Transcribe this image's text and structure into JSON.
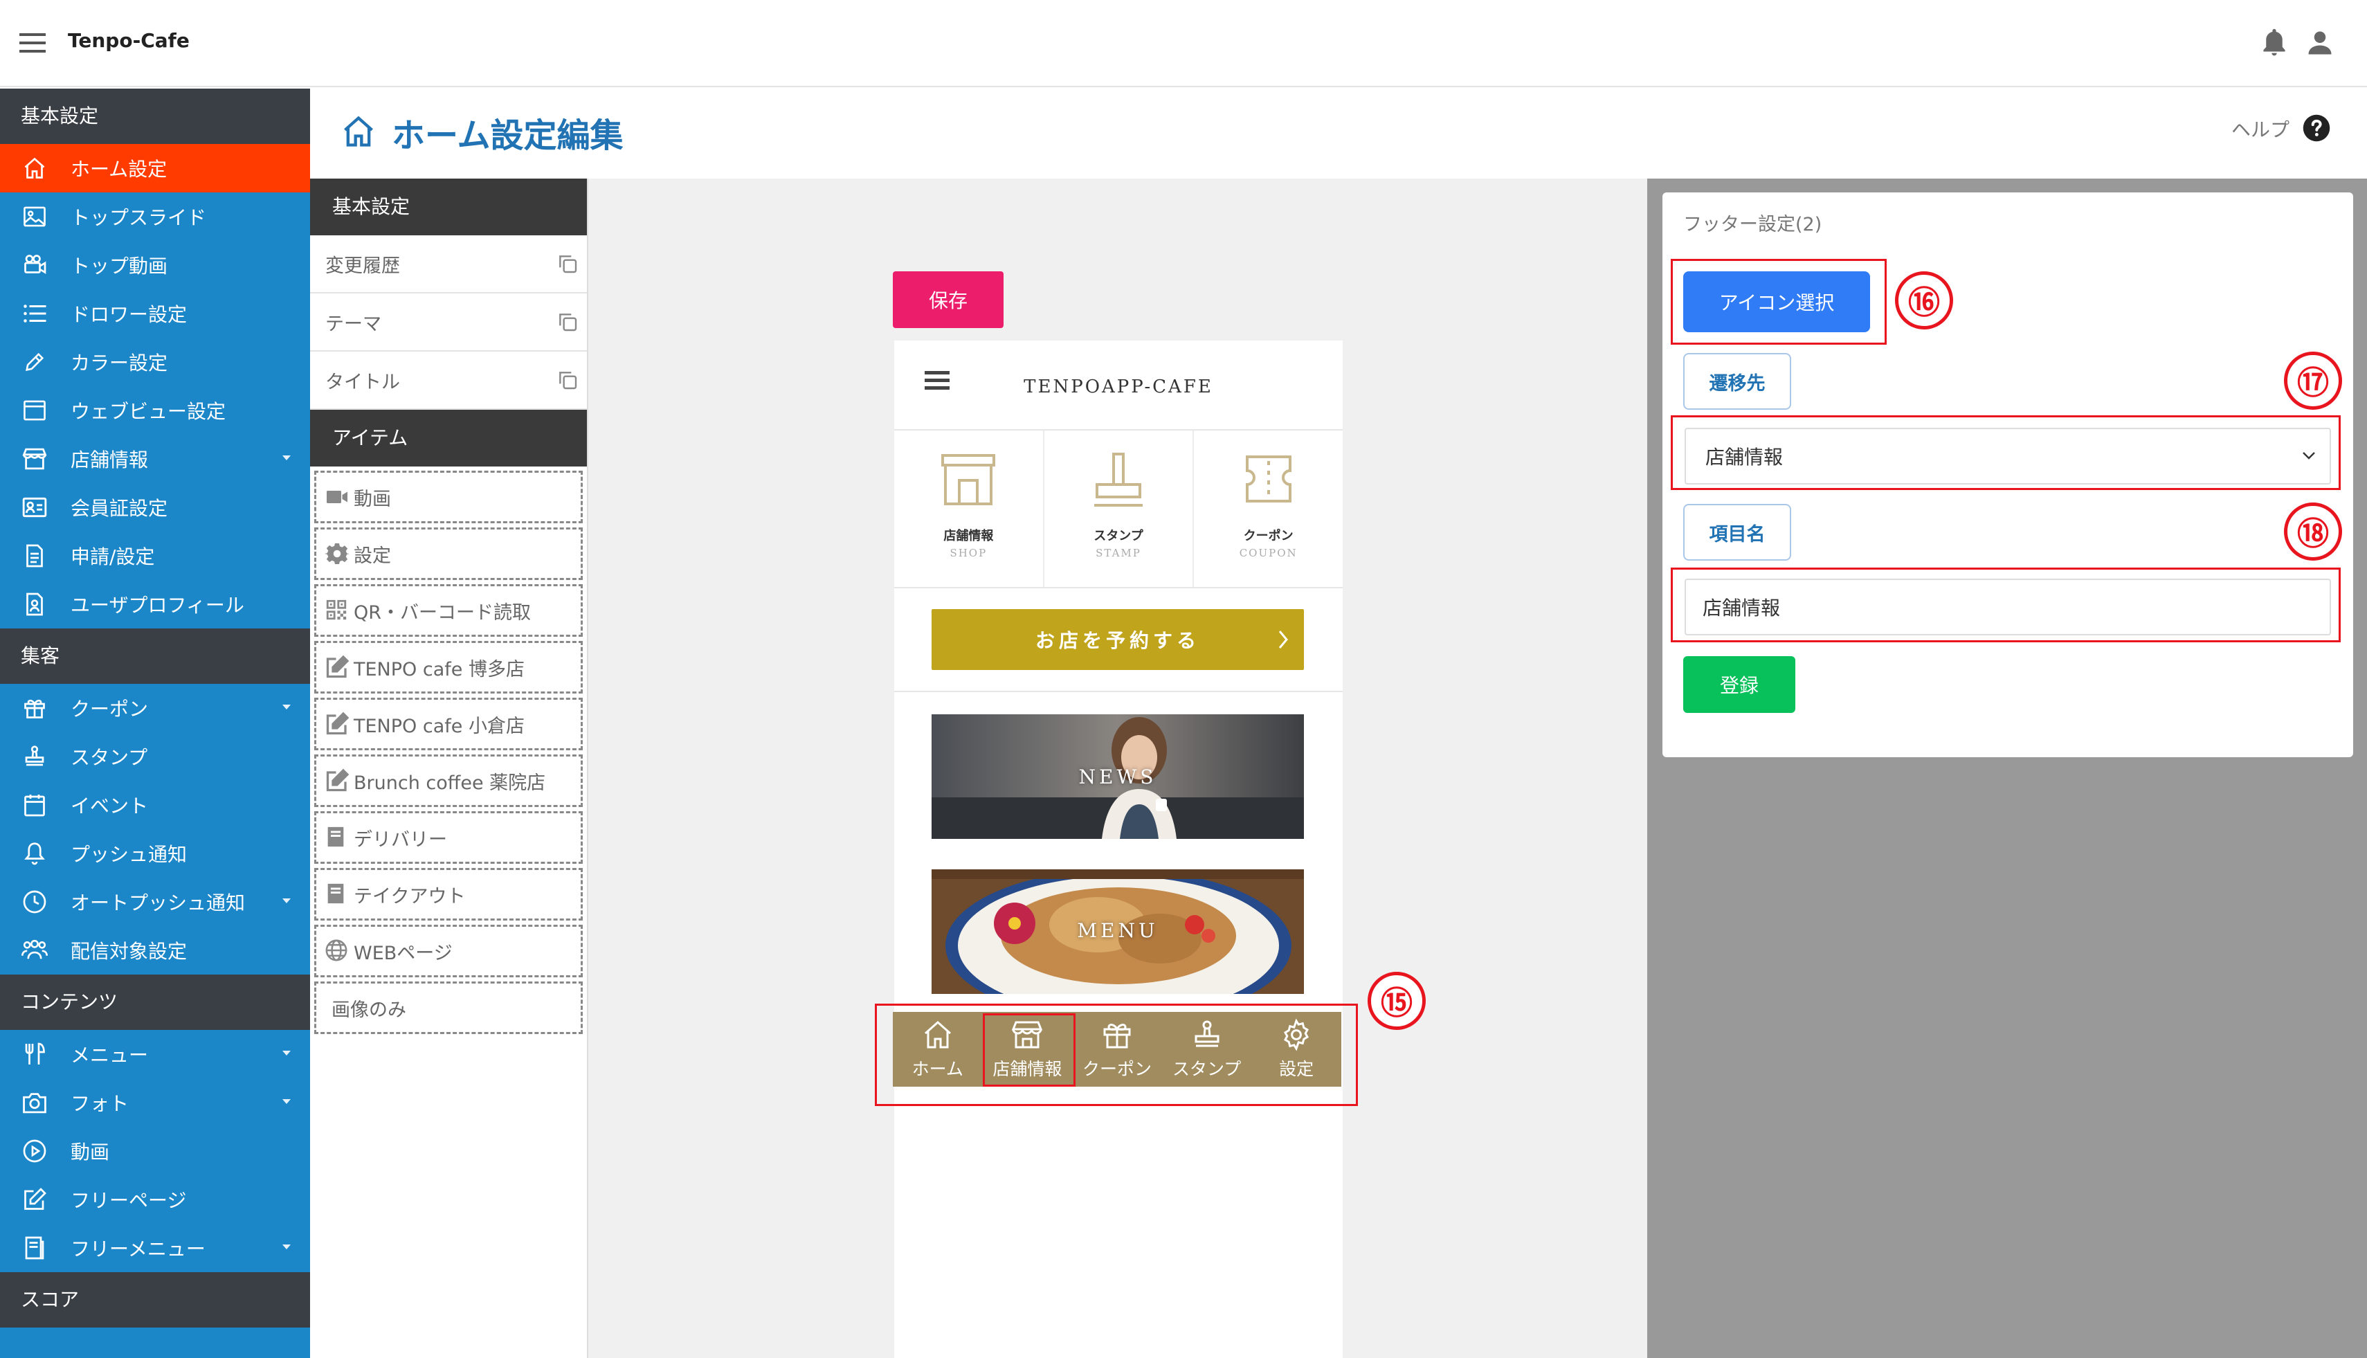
{
  "app": {
    "title": "Tenpo-Cafe"
  },
  "sidebar": {
    "sections": [
      {
        "heading": "基本設定",
        "items": [
          {
            "label": "ホーム設定",
            "icon": "home-icon",
            "active": true
          },
          {
            "label": "トップスライド",
            "icon": "image-icon"
          },
          {
            "label": "トップ動画",
            "icon": "video-camera-icon"
          },
          {
            "label": "ドロワー設定",
            "icon": "list-icon"
          },
          {
            "label": "カラー設定",
            "icon": "pencil-icon"
          },
          {
            "label": "ウェブビュー設定",
            "icon": "browser-icon"
          },
          {
            "label": "店舗情報",
            "icon": "store-icon",
            "caret": true
          },
          {
            "label": "会員証設定",
            "icon": "id-card-icon"
          },
          {
            "label": "申請/設定",
            "icon": "document-icon"
          },
          {
            "label": "ユーザプロフィール",
            "icon": "profile-icon"
          }
        ]
      },
      {
        "heading": "集客",
        "items": [
          {
            "label": "クーポン",
            "icon": "gift-icon",
            "caret": true
          },
          {
            "label": "スタンプ",
            "icon": "stamp-icon"
          },
          {
            "label": "イベント",
            "icon": "calendar-icon"
          },
          {
            "label": "プッシュ通知",
            "icon": "bell-icon"
          },
          {
            "label": "オートプッシュ通知",
            "icon": "clock-icon",
            "caret": true
          },
          {
            "label": "配信対象設定",
            "icon": "users-icon"
          }
        ]
      },
      {
        "heading": "コンテンツ",
        "items": [
          {
            "label": "メニュー",
            "icon": "utensils-icon",
            "caret": true
          },
          {
            "label": "フォト",
            "icon": "camera-icon",
            "caret": true
          },
          {
            "label": "動画",
            "icon": "play-icon"
          },
          {
            "label": "フリーページ",
            "icon": "edit-icon"
          },
          {
            "label": "フリーメニュー",
            "icon": "book-icon",
            "caret": true
          }
        ]
      },
      {
        "heading": "スコア",
        "items": []
      }
    ]
  },
  "header": {
    "title": "ホーム設定編集",
    "help": "ヘルプ"
  },
  "item_panel": {
    "basic_heading": "基本設定",
    "basic_rows": [
      "変更履歴",
      "テーマ",
      "タイトル"
    ],
    "items_heading": "アイテム",
    "items": [
      {
        "label": "動画",
        "icon": "video-icon"
      },
      {
        "label": "設定",
        "icon": "gear-icon"
      },
      {
        "label": "QR・バーコード読取",
        "icon": "qr-icon"
      },
      {
        "label": "TENPO cafe 博多店",
        "icon": "edit-icon"
      },
      {
        "label": "TENPO cafe 小倉店",
        "icon": "edit-icon"
      },
      {
        "label": "Brunch coffee 薬院店",
        "icon": "edit-icon"
      },
      {
        "label": "デリバリー",
        "icon": "book-icon"
      },
      {
        "label": "テイクアウト",
        "icon": "book-icon"
      },
      {
        "label": "WEBページ",
        "icon": "globe-icon"
      },
      {
        "label": "画像のみ",
        "icon": ""
      }
    ]
  },
  "preview": {
    "save_label": "保存",
    "brand": "TENPOAPP-CAFE",
    "categories": [
      {
        "label": "店舗情報",
        "sub": "SHOP",
        "icon": "store-icon"
      },
      {
        "label": "スタンプ",
        "sub": "STAMP",
        "icon": "stamp-icon"
      },
      {
        "label": "クーポン",
        "sub": "COUPON",
        "icon": "ticket-icon"
      }
    ],
    "reserve_label": "お店を予約する",
    "banners": [
      "NEWS",
      "MENU"
    ],
    "footer_nav": [
      {
        "label": "ホーム",
        "icon": "home-icon"
      },
      {
        "label": "店舗情報",
        "icon": "store-icon",
        "highlighted": true
      },
      {
        "label": "クーポン",
        "icon": "gift-icon"
      },
      {
        "label": "スタンプ",
        "icon": "stamp-icon"
      },
      {
        "label": "設定",
        "icon": "gear-icon"
      }
    ]
  },
  "annotations": [
    "⑮",
    "⑯",
    "⑰",
    "⑱"
  ],
  "footer_settings": {
    "title": "フッター設定(2)",
    "icon_select_label": "アイコン選択",
    "destination_label": "遷移先",
    "destination_value": "店舗情報",
    "item_name_label": "項目名",
    "item_name_value": "店舗情報",
    "register_label": "登録"
  },
  "colors": {
    "sidebar": "#1b86c8",
    "active": "#ff3b00",
    "save": "#ec1d6b",
    "reserve": "#c0a51c",
    "footer_nav": "#a08c5e",
    "icon_select": "#2f7cf6",
    "register": "#08c15b",
    "annotation": "#e8141e"
  }
}
